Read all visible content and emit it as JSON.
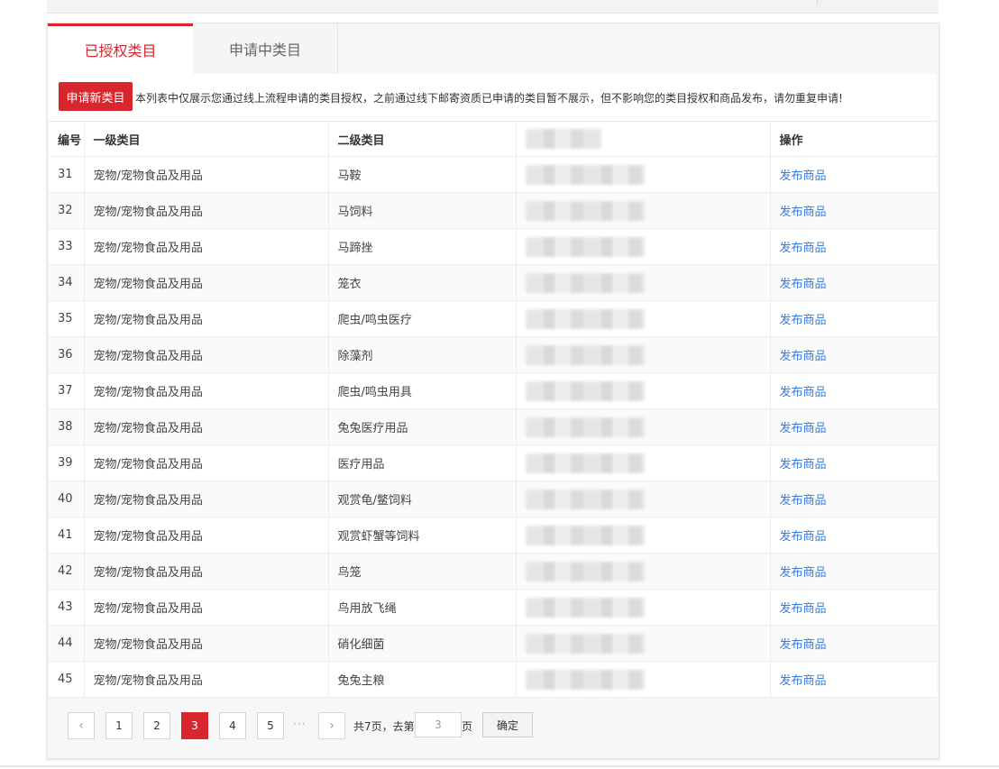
{
  "tabs": [
    {
      "label": "已授权类目",
      "active": true
    },
    {
      "label": "申请中类目",
      "active": false
    }
  ],
  "notice": {
    "button_label": "申请新类目",
    "text": "本列表中仅展示您通过线上流程申请的类目授权，之前通过线下邮寄资质已申请的类目暂不展示，但不影响您的类目授权和商品发布，请勿重复申请!"
  },
  "table": {
    "headers": {
      "id": "编号",
      "level1": "一级类目",
      "level2": "二级类目",
      "op": "操作"
    },
    "rows": [
      {
        "id": "31",
        "level1": "宠物/宠物食品及用品",
        "level2": "马鞍",
        "op": "发布商品"
      },
      {
        "id": "32",
        "level1": "宠物/宠物食品及用品",
        "level2": "马饲料",
        "op": "发布商品"
      },
      {
        "id": "33",
        "level1": "宠物/宠物食品及用品",
        "level2": "马蹄挫",
        "op": "发布商品"
      },
      {
        "id": "34",
        "level1": "宠物/宠物食品及用品",
        "level2": "笼衣",
        "op": "发布商品"
      },
      {
        "id": "35",
        "level1": "宠物/宠物食品及用品",
        "level2": "爬虫/鸣虫医疗",
        "op": "发布商品"
      },
      {
        "id": "36",
        "level1": "宠物/宠物食品及用品",
        "level2": "除藻剂",
        "op": "发布商品"
      },
      {
        "id": "37",
        "level1": "宠物/宠物食品及用品",
        "level2": "爬虫/鸣虫用具",
        "op": "发布商品"
      },
      {
        "id": "38",
        "level1": "宠物/宠物食品及用品",
        "level2": "兔兔医疗用品",
        "op": "发布商品"
      },
      {
        "id": "39",
        "level1": "宠物/宠物食品及用品",
        "level2": "医疗用品",
        "op": "发布商品"
      },
      {
        "id": "40",
        "level1": "宠物/宠物食品及用品",
        "level2": "观赏龟/鳖饲料",
        "op": "发布商品"
      },
      {
        "id": "41",
        "level1": "宠物/宠物食品及用品",
        "level2": "观赏虾蟹等饲料",
        "op": "发布商品"
      },
      {
        "id": "42",
        "level1": "宠物/宠物食品及用品",
        "level2": "鸟笼",
        "op": "发布商品"
      },
      {
        "id": "43",
        "level1": "宠物/宠物食品及用品",
        "level2": "鸟用放飞绳",
        "op": "发布商品"
      },
      {
        "id": "44",
        "level1": "宠物/宠物食品及用品",
        "level2": "硝化细菌",
        "op": "发布商品"
      },
      {
        "id": "45",
        "level1": "宠物/宠物食品及用品",
        "level2": "兔兔主粮",
        "op": "发布商品"
      }
    ]
  },
  "pagination": {
    "prev_icon": "‹",
    "next_icon": "›",
    "pages": [
      "1",
      "2",
      "3",
      "4",
      "5"
    ],
    "current": "3",
    "ellipsis": "···",
    "total_text": "共7页，去第",
    "goto_value": "3",
    "page_unit": "页",
    "confirm_label": "确定"
  },
  "colors": {
    "accent": "#d9262e",
    "link": "#3a7bd5"
  }
}
